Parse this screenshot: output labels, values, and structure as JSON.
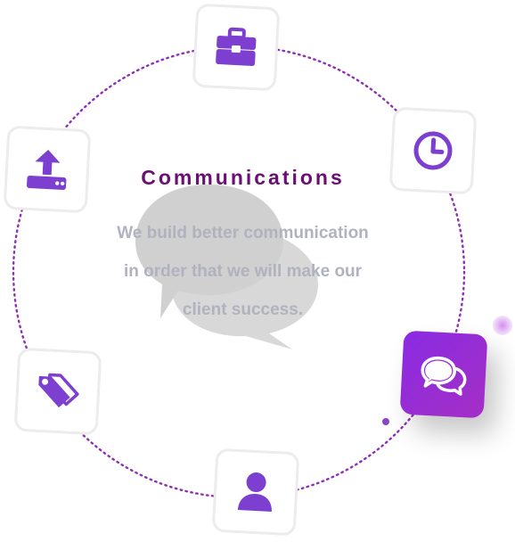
{
  "center": {
    "title": "Communications",
    "description_lines": [
      "We build better communication",
      "in order that we will make our",
      "client success."
    ]
  },
  "nodes": [
    {
      "id": "business",
      "icon": "briefcase-icon",
      "active": false
    },
    {
      "id": "time",
      "icon": "clock-icon",
      "active": false
    },
    {
      "id": "communications",
      "icon": "chat-bubbles-icon",
      "active": true
    },
    {
      "id": "user",
      "icon": "user-icon",
      "active": false
    },
    {
      "id": "tags",
      "icon": "tags-icon",
      "active": false
    },
    {
      "id": "upload",
      "icon": "upload-icon",
      "active": false
    }
  ],
  "colors": {
    "accent": "#7c3fd0",
    "active_gradient": [
      "#8a2be2",
      "#a42fc5"
    ],
    "title": "#6a0f73",
    "text": "#b0b2bf",
    "ring": "#8e2fb5"
  }
}
